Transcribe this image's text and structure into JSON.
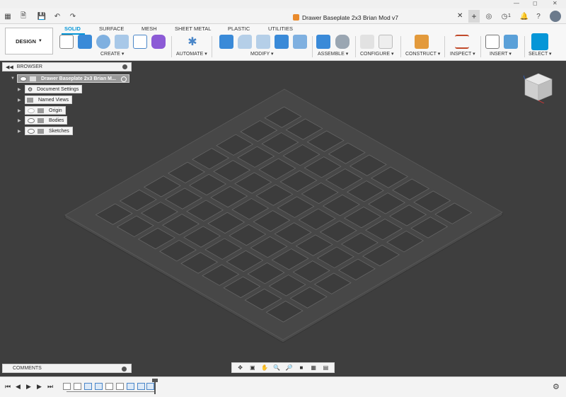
{
  "document": {
    "title": "Drawer Baseplate 2x3 Brian Mod v7"
  },
  "workspace": {
    "design_label": "DESIGN"
  },
  "ribbon_tabs": [
    "SOLID",
    "SURFACE",
    "MESH",
    "SHEET METAL",
    "PLASTIC",
    "UTILITIES"
  ],
  "ribbon_groups": {
    "create": "CREATE",
    "automate": "AUTOMATE",
    "modify": "MODIFY",
    "assemble": "ASSEMBLE",
    "configure": "CONFIGURE",
    "construct": "CONSTRUCT",
    "inspect": "INSPECT",
    "insert": "INSERT",
    "select": "SELECT"
  },
  "browser": {
    "title": "BROWSER",
    "root": "Drawer Baseplate 2x3 Brian M...",
    "items": [
      "Document Settings",
      "Named Views",
      "Origin",
      "Bodies",
      "Sketches"
    ]
  },
  "comments": {
    "title": "COMMENTS"
  },
  "header_badges": {
    "jobs_count": "1"
  },
  "colors": {
    "accent": "#0696d7",
    "viewport": "#3e3e3e"
  }
}
